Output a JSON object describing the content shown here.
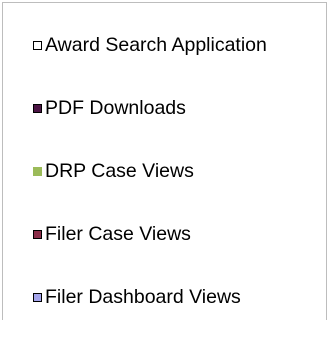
{
  "chart_data": {
    "type": "legend",
    "legend_placement": "right",
    "entries": [
      {
        "label": "Award Search Application",
        "color": "#ffffff",
        "border": true
      },
      {
        "label": "PDF Downloads",
        "color": "#4b1444",
        "border": true
      },
      {
        "label": "DRP Case Views",
        "color": "#9bbb59",
        "border": false
      },
      {
        "label": "Filer Case Views",
        "color": "#8b2e49",
        "border": true
      },
      {
        "label": "Filer Dashboard Views",
        "color": "#a5a5ec",
        "border": true
      }
    ]
  }
}
